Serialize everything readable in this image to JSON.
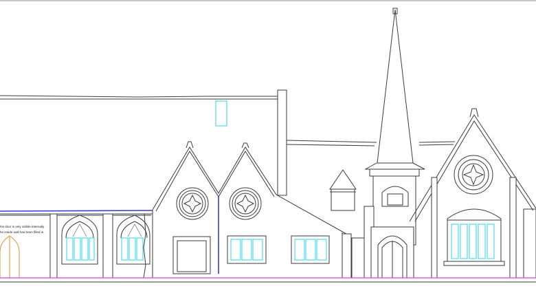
{
  "annotation": {
    "line1": "his door is only visible internally",
    "line2": "he inside wall has been filled in."
  },
  "colors": {
    "outline": "#3a3a3a",
    "glazing": "#29d6e8",
    "ground_line": "#e23be2",
    "section_line": "#3b3bd6",
    "door": "#d8902a"
  }
}
